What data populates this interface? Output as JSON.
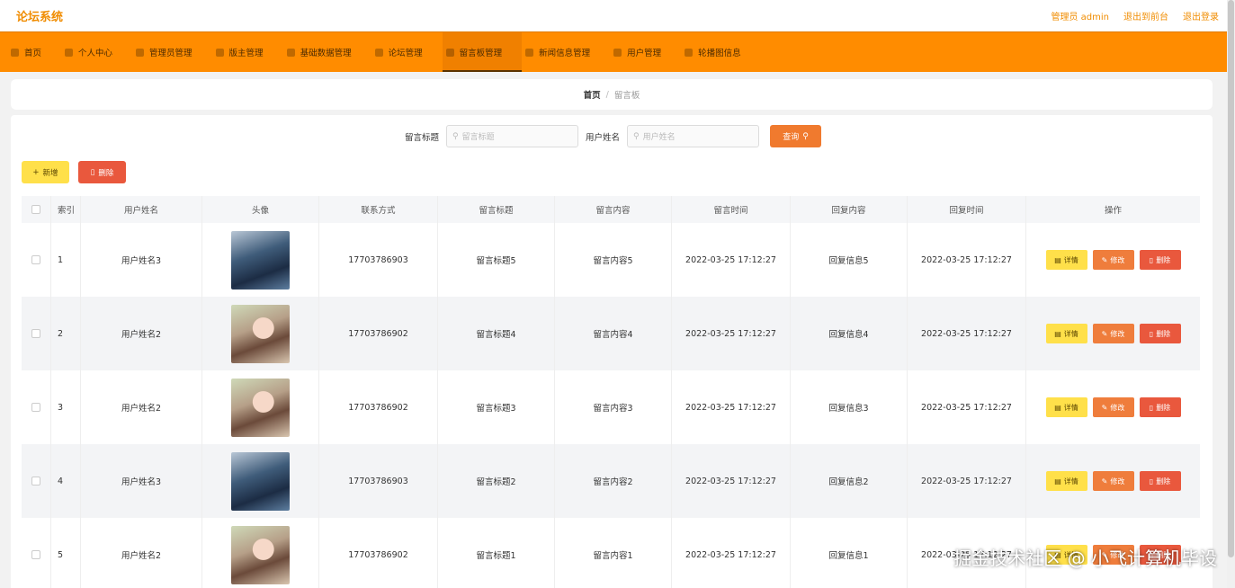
{
  "app": {
    "title": "论坛系统"
  },
  "top_links": {
    "admin": "管理员 admin",
    "front": "退出到前台",
    "logout": "退出登录"
  },
  "nav": [
    {
      "label": "首页"
    },
    {
      "label": "个人中心"
    },
    {
      "label": "管理员管理"
    },
    {
      "label": "版主管理"
    },
    {
      "label": "基础数据管理"
    },
    {
      "label": "论坛管理"
    },
    {
      "label": "留言板管理",
      "active": true
    },
    {
      "label": "新闻信息管理"
    },
    {
      "label": "用户管理"
    },
    {
      "label": "轮播图信息"
    }
  ],
  "breadcrumb": {
    "home": "首页",
    "sep": "/",
    "current": "留言板"
  },
  "search": {
    "title_label": "留言标题",
    "title_placeholder": "留言标题",
    "name_label": "用户姓名",
    "name_placeholder": "用户姓名",
    "query_label": "查询"
  },
  "toolbar": {
    "add_label": "新增",
    "delete_label": "删除"
  },
  "table": {
    "headers": {
      "index": "索引",
      "name": "用户姓名",
      "avatar": "头像",
      "phone": "联系方式",
      "title": "留言标题",
      "content": "留言内容",
      "time": "留言时间",
      "reply": "回复内容",
      "reply_time": "回复时间",
      "op": "操作"
    },
    "ops": {
      "detail": "详情",
      "edit": "修改",
      "delete": "删除"
    },
    "rows": [
      {
        "index": "1",
        "name": "用户姓名3",
        "avatar": "boy",
        "phone": "17703786903",
        "title": "留言标题5",
        "content": "留言内容5",
        "time": "2022-03-25 17:12:27",
        "reply": "回复信息5",
        "reply_time": "2022-03-25 17:12:27"
      },
      {
        "index": "2",
        "name": "用户姓名2",
        "avatar": "girl",
        "phone": "17703786902",
        "title": "留言标题4",
        "content": "留言内容4",
        "time": "2022-03-25 17:12:27",
        "reply": "回复信息4",
        "reply_time": "2022-03-25 17:12:27"
      },
      {
        "index": "3",
        "name": "用户姓名2",
        "avatar": "girl",
        "phone": "17703786902",
        "title": "留言标题3",
        "content": "留言内容3",
        "time": "2022-03-25 17:12:27",
        "reply": "回复信息3",
        "reply_time": "2022-03-25 17:12:27"
      },
      {
        "index": "4",
        "name": "用户姓名3",
        "avatar": "boy",
        "phone": "17703786903",
        "title": "留言标题2",
        "content": "留言内容2",
        "time": "2022-03-25 17:12:27",
        "reply": "回复信息2",
        "reply_time": "2022-03-25 17:12:27"
      },
      {
        "index": "5",
        "name": "用户姓名2",
        "avatar": "girl",
        "phone": "17703786902",
        "title": "留言标题1",
        "content": "留言内容1",
        "time": "2022-03-25 17:12:27",
        "reply": "回复信息1",
        "reply_time": "2022-03-25 17:12:27"
      }
    ]
  },
  "watermark": "掘金技术社区 @ 小飞计算机毕设"
}
